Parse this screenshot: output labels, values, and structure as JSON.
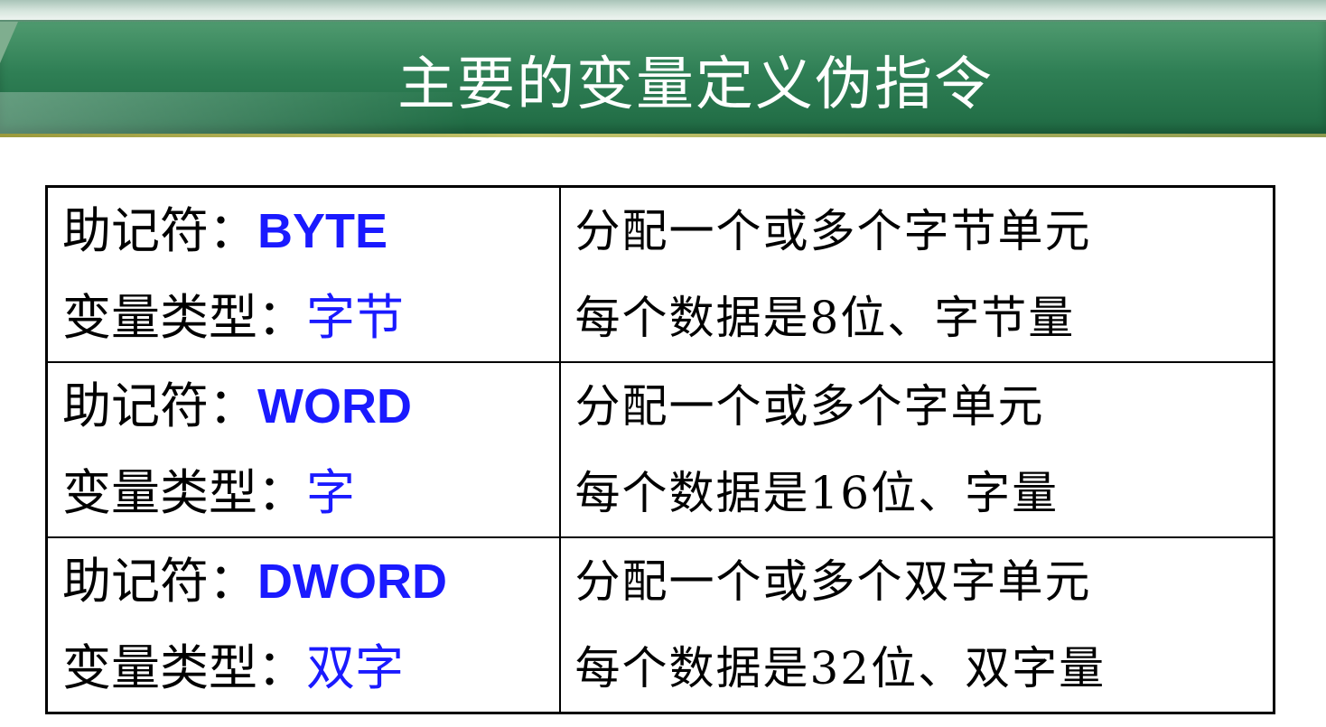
{
  "header": {
    "title": "主要的变量定义伪指令"
  },
  "colors": {
    "title_bar": "#2f7f55",
    "accent_blue": "#1a1aff",
    "text": "#000000"
  },
  "table": {
    "rows": [
      {
        "mnemonic_label": "助记符：",
        "mnemonic": "BYTE",
        "type_label": "变量类型：",
        "type": "字节",
        "desc1": "分配一个或多个字节单元",
        "desc2": "每个数据是8位、字节量"
      },
      {
        "mnemonic_label": "助记符：",
        "mnemonic": "WORD",
        "type_label": "变量类型：",
        "type": "字",
        "desc1": "分配一个或多个字单元",
        "desc2": "每个数据是16位、字量"
      },
      {
        "mnemonic_label": "助记符：",
        "mnemonic": "DWORD",
        "type_label": "变量类型：",
        "type": "双字",
        "desc1": "分配一个或多个双字单元",
        "desc2": "每个数据是32位、双字量"
      }
    ]
  }
}
